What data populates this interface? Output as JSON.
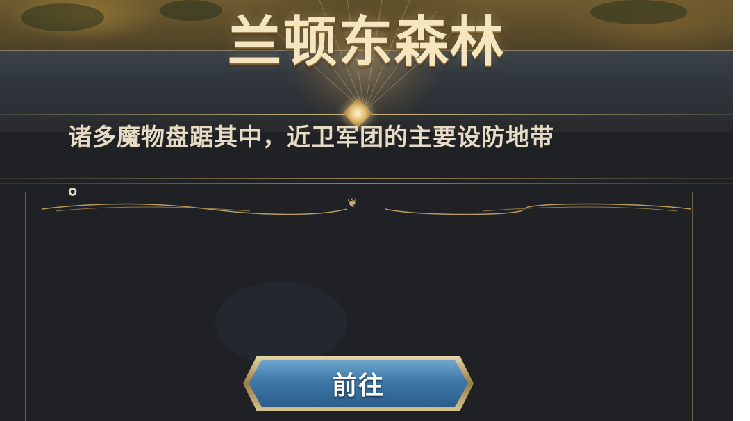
{
  "header": {
    "title": "兰顿东森林"
  },
  "content": {
    "description": "诸多魔物盘踞其中，近卫军团的主要设防地带",
    "description_tail": "。"
  },
  "actions": {
    "goto_label": "前往"
  },
  "colors": {
    "title_gold": "#f6e6c0",
    "panel_bg": "#1f2124",
    "button_blue": "#3f78a8",
    "trim_gold": "#c8ad76"
  }
}
